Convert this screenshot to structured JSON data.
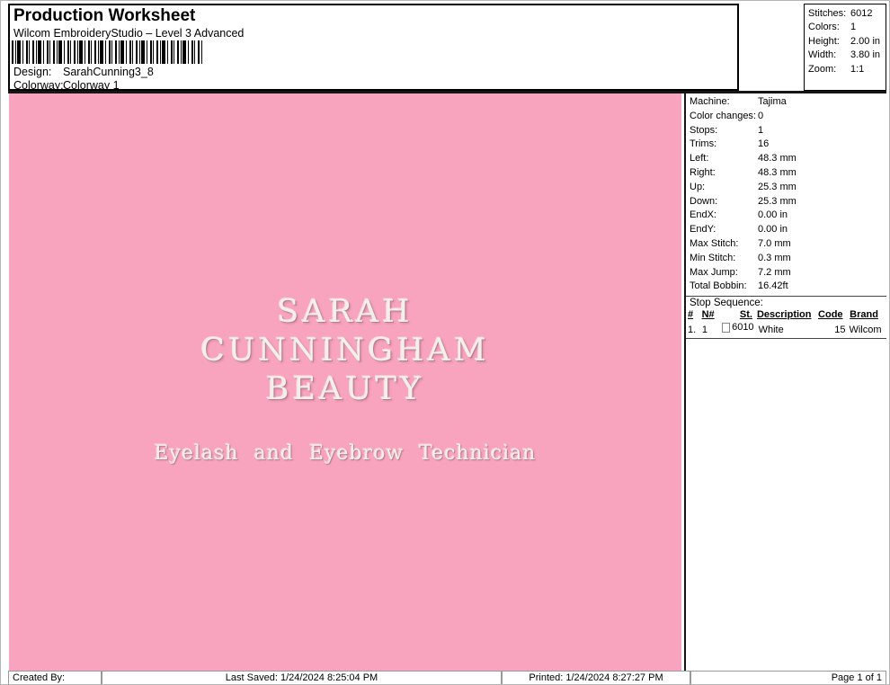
{
  "header": {
    "title": "Production Worksheet",
    "subtitle": "Wilcom EmbroideryStudio – Level 3 Advanced",
    "design_label": "Design:",
    "design_value": "SarahCunning3_8",
    "colorway_label": "Colorway:",
    "colorway_value": "Colorway 1"
  },
  "stats_box": {
    "rows": [
      {
        "label": "Stitches:",
        "value": "6012"
      },
      {
        "label": "Colors:",
        "value": "1"
      },
      {
        "label": "Height:",
        "value": "2.00 in"
      },
      {
        "label": "Width:",
        "value": "3.80 in"
      },
      {
        "label": "Zoom:",
        "value": "1:1"
      }
    ]
  },
  "machine_panel": {
    "rows": [
      {
        "label": "Machine:",
        "value": "Tajima"
      },
      {
        "label": "Color changes:",
        "value": "0"
      },
      {
        "label": "Stops:",
        "value": "1"
      },
      {
        "label": "Trims:",
        "value": "16"
      },
      {
        "label": "Left:",
        "value": "48.3 mm"
      },
      {
        "label": "Right:",
        "value": "48.3 mm"
      },
      {
        "label": "Up:",
        "value": "25.3 mm"
      },
      {
        "label": "Down:",
        "value": "25.3 mm"
      },
      {
        "label": "EndX:",
        "value": "0.00 in"
      },
      {
        "label": "EndY:",
        "value": "0.00 in"
      },
      {
        "label": "Max Stitch:",
        "value": "7.0 mm"
      },
      {
        "label": "Min Stitch:",
        "value": "0.3 mm"
      },
      {
        "label": "Max Jump:",
        "value": "7.2 mm"
      },
      {
        "label": "Total Bobbin:",
        "value": "16.42ft"
      }
    ],
    "stop_sequence_label": "Stop Sequence:",
    "stop_table": {
      "headers": [
        "#",
        "N#",
        "St.",
        "Description",
        "Code",
        "Brand"
      ],
      "row": {
        "index": "1.",
        "needle": "1",
        "stitch_code": "6010",
        "description": "White",
        "code": "15",
        "brand": "Wilcom"
      }
    }
  },
  "design_preview": {
    "line1": "SARAH",
    "line2": "CUNNINGHAM",
    "line3": "BEAUTY",
    "tagline": "Eyelash and Eyebrow Technician",
    "fabric_color": "#F9A4BF",
    "thread_color": "#F3EFE9"
  },
  "footer": {
    "created_by": "Created By:",
    "last_saved": "Last Saved: 1/24/2024 8:25:04 PM",
    "printed": "Printed: 1/24/2024 8:27:27 PM",
    "page": "Page 1 of 1"
  },
  "icons": {
    "barcode_icon": "vertical-bars",
    "checkbox_icon": "unchecked-box"
  }
}
